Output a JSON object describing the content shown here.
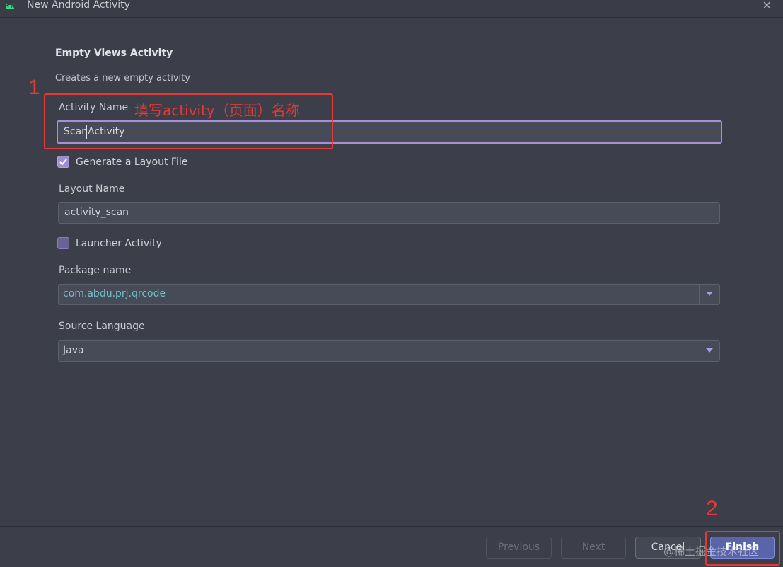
{
  "window": {
    "title": "New Android Activity",
    "close_glyph": "✕"
  },
  "header": {
    "heading": "Empty Views Activity",
    "description": "Creates a new empty activity"
  },
  "form": {
    "activity_name_label": "Activity Name",
    "activity_name_value": "ScanActivity",
    "generate_layout_label": "Generate a Layout File",
    "generate_layout_checked": true,
    "layout_name_label": "Layout Name",
    "layout_name_value": "activity_scan",
    "launcher_label": "Launcher Activity",
    "launcher_checked": false,
    "package_label": "Package name",
    "package_value": "com.abdu.prj.qrcode",
    "language_label": "Source Language",
    "language_value": "Java"
  },
  "annotations": {
    "num1": "1",
    "num2": "2",
    "note1": "填写activity（页面）名称",
    "color": "#e53935"
  },
  "footer": {
    "previous_label": "Previous",
    "next_label": "Next",
    "cancel_label": "Cancel",
    "finish_label": "Finish"
  },
  "watermark": "@稀土掘金技术社区",
  "colors": {
    "accent": "#a78fd6",
    "primary_button": "#5a64a8",
    "background": "#3c3f4a"
  }
}
